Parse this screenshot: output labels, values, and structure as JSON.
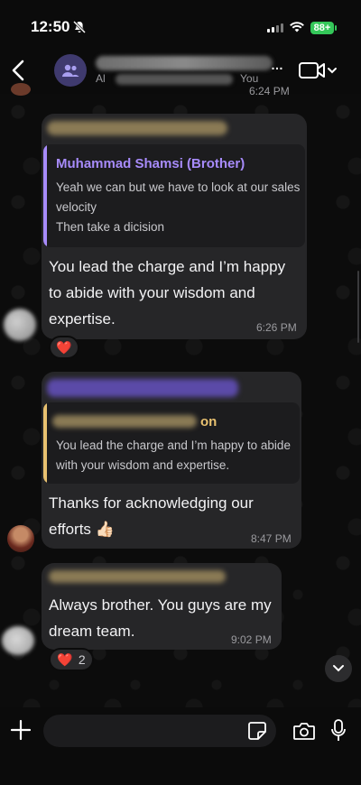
{
  "status_bar": {
    "time": "12:50",
    "battery": "88+"
  },
  "header": {
    "subtitle_prefix": "Al",
    "subtitle_suffix": "You",
    "icons": [
      "back-chevron-icon",
      "group-icon",
      "video-call-icon",
      "chevron-down-icon"
    ]
  },
  "messages": [
    {
      "top_time": "6:24 PM"
    },
    {
      "quote_name": "Muhammad Shamsi (Brother)",
      "quote_line1": "Yeah we can but we have to look at our sales",
      "quote_line2": "velocity",
      "quote_line3": "Then take a dicision",
      "text_line1": "You lead the charge and I’m happy",
      "text_line2": "to abide with your wisdom and",
      "text_line3": "expertise.",
      "time": "6:26 PM",
      "reaction": "❤️"
    },
    {
      "quote_name_suffix": "on",
      "quote_line1": "You lead the charge and I’m happy to abide",
      "quote_line2": "with your wisdom and expertise.",
      "text_line1": "Thanks for acknowledging our",
      "text_line2": "efforts 👍🏻",
      "time": "8:47 PM"
    },
    {
      "text_line1": "Always brother. You guys are my",
      "text_line2": "dream team.",
      "time": "9:02 PM",
      "reaction": "❤️",
      "reaction_count": "2"
    }
  ],
  "colors": {
    "quote_purple": "#a78bfa",
    "quote_yellow": "#e8c170",
    "bubble": "#262628",
    "battery": "#34c759"
  }
}
